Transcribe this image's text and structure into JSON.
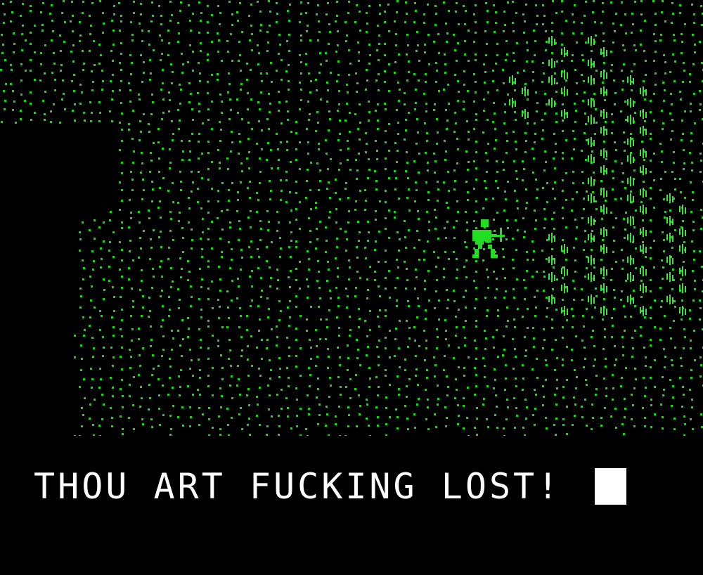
{
  "game": {
    "screen": "overworld-map",
    "palette": {
      "background": "#000000",
      "grass": "#1fd41f",
      "forest": "#36e836",
      "hero": "#22dd22",
      "text": "#ffffff"
    },
    "map": {
      "terrain_types": [
        "grass",
        "forest",
        "void"
      ],
      "hero": {
        "icon": "hero-with-shield-and-sword"
      }
    },
    "message": {
      "text": "THOU ART FUCKING LOST!",
      "cursor": "block-cursor"
    }
  }
}
